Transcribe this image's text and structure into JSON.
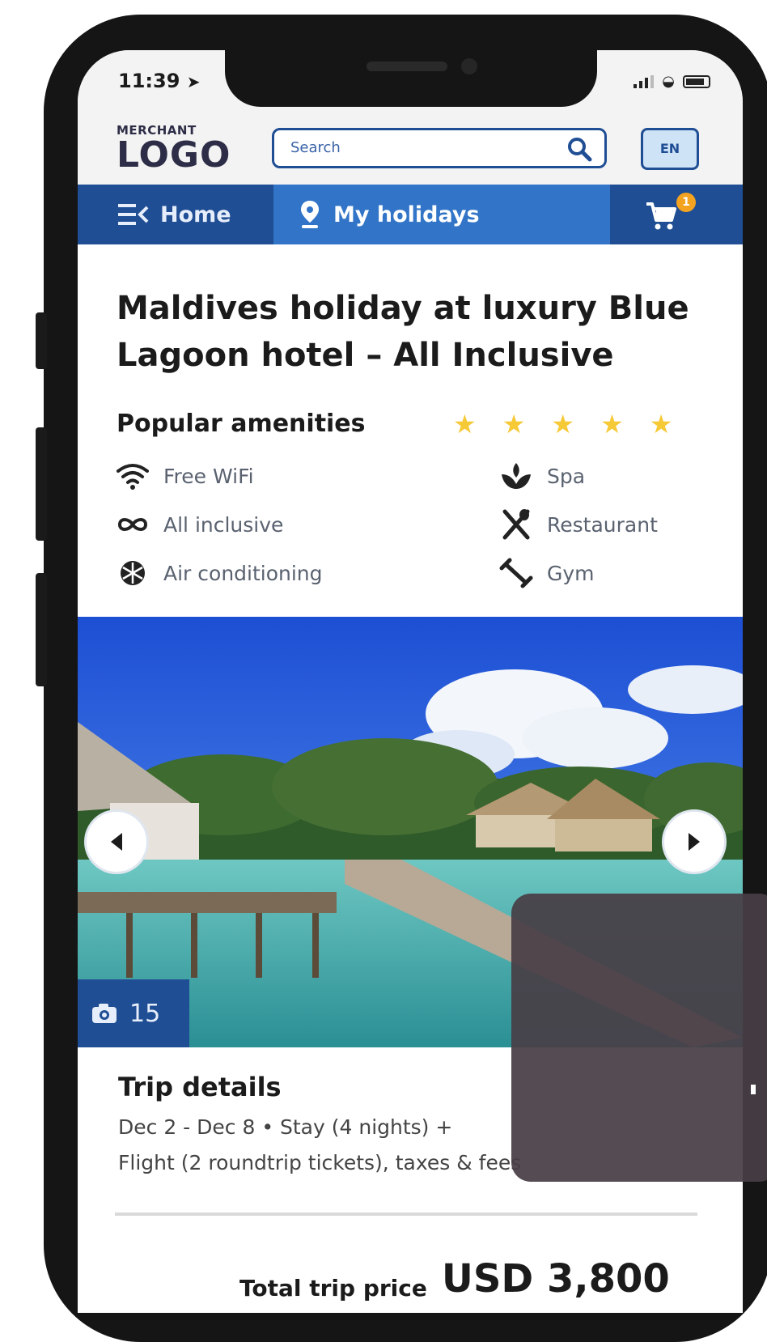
{
  "status_bar": {
    "time": "11:39"
  },
  "header": {
    "logo_top": "MERCHANT",
    "logo_main": "LOGO",
    "search_placeholder": "Search",
    "language": "EN"
  },
  "nav": {
    "home_label": "Home",
    "holidays_label": "My holidays",
    "cart_count": "1"
  },
  "listing": {
    "title": "Maldives holiday at luxury Blue Lagoon hotel – All Inclusive",
    "amenities_title": "Popular amenities",
    "rating_stars": 5,
    "amenities_left": [
      {
        "label": "Free WiFi",
        "icon": "wifi-icon"
      },
      {
        "label": "All inclusive",
        "icon": "infinity-icon"
      },
      {
        "label": "Air conditioning",
        "icon": "snowflake-icon"
      }
    ],
    "amenities_right": [
      {
        "label": "Spa",
        "icon": "spa-icon"
      },
      {
        "label": "Restaurant",
        "icon": "restaurant-icon"
      },
      {
        "label": "Gym",
        "icon": "gym-icon"
      }
    ]
  },
  "gallery": {
    "photo_count": "15"
  },
  "trip": {
    "title": "Trip details",
    "line1": "Dec 2 - Dec 8 • Stay (4 nights) +",
    "line2": "Flight (2 roundtrip tickets), taxes & fees"
  },
  "total": {
    "label": "Total trip price",
    "price": "USD 3,800"
  },
  "colors": {
    "brand_blue": "#1f4e94",
    "active_tab": "#3275c8",
    "star": "#f6c936",
    "badge": "#f4a321"
  }
}
